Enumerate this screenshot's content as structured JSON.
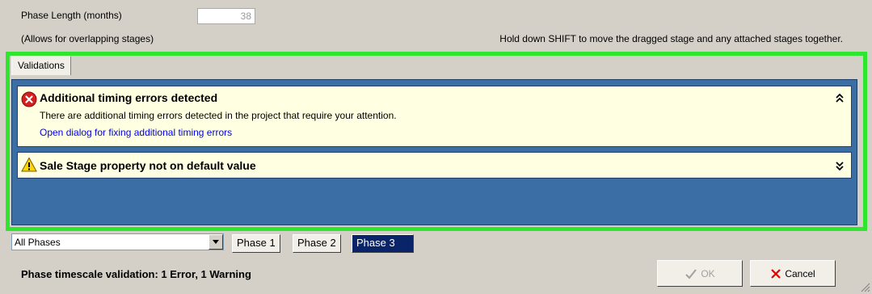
{
  "top": {
    "phase_length_label": "Phase Length (months)",
    "phase_length_value": "38",
    "overlap_note": "(Allows for overlapping stages)",
    "shift_hint": "Hold down SHIFT to move the dragged stage and any attached stages together."
  },
  "tabs": [
    "Validations"
  ],
  "validations": {
    "error": {
      "icon": "error-icon",
      "title": "Additional timing errors detected",
      "description": "There are additional timing errors detected in the project that require your attention.",
      "link": "Open dialog for fixing additional timing errors",
      "toggle_icon": "collapse-icon"
    },
    "warning": {
      "icon": "warning-icon",
      "title": "Sale Stage property not on default value",
      "toggle_icon": "expand-icon"
    }
  },
  "phase_filter": {
    "selected": "All Phases",
    "buttons": [
      "Phase 1",
      "Phase 2",
      "Phase 3"
    ],
    "active": "Phase 3"
  },
  "status_text": "Phase timescale validation: 1 Error, 1 Warning",
  "buttons": {
    "ok": "OK",
    "cancel": "Cancel"
  },
  "colors": {
    "highlight": "#2ee62e",
    "panel_bg": "#3b6ea5",
    "card_bg": "#ffffe1",
    "link": "#0000e6",
    "active_phase": "#0a246a"
  }
}
